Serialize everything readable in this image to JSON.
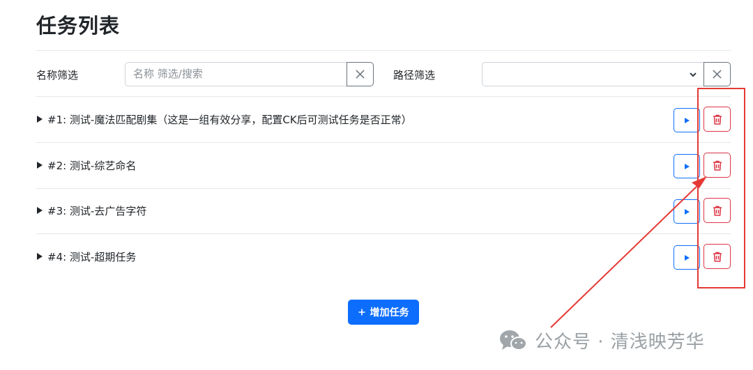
{
  "page": {
    "title": "任务列表"
  },
  "filters": {
    "name_label": "名称筛选",
    "name_placeholder": "名称 筛选/搜索",
    "path_label": "路径筛选",
    "path_value": ""
  },
  "tasks": [
    {
      "title": "#1: 测试-魔法匹配剧集（这是一组有效分享，配置CK后可测试任务是否正常）"
    },
    {
      "title": "#2: 测试-综艺命名"
    },
    {
      "title": "#3: 测试-去广告字符"
    },
    {
      "title": "#4: 测试-超期任务"
    }
  ],
  "actions": {
    "add_task_label": "增加任务",
    "add_icon": "plus-icon",
    "run_icon": "play-icon",
    "delete_icon": "trash-icon"
  },
  "watermark": {
    "text": "公众号 · 清浅映芳华",
    "icon": "wechat-icon"
  },
  "colors": {
    "primary": "#0d6efd",
    "danger": "#dc3545",
    "annotation": "#e53935",
    "border": "#ced4da"
  }
}
